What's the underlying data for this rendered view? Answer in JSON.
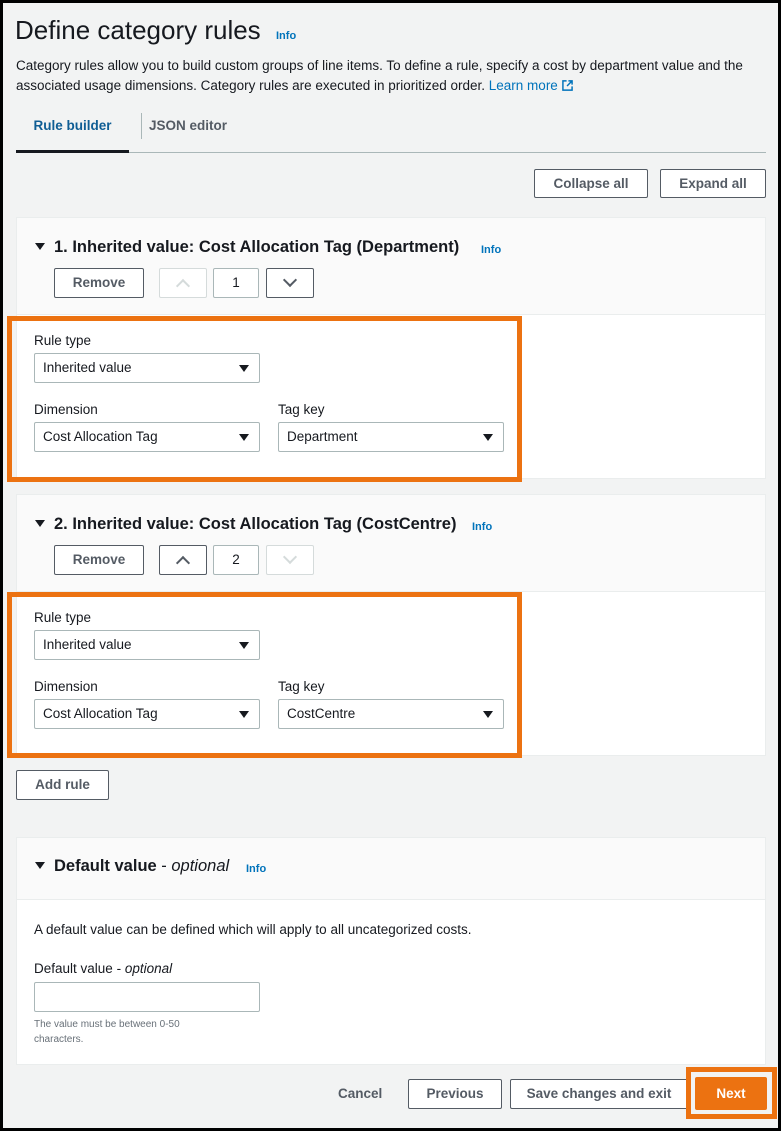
{
  "page": {
    "title": "Define category rules",
    "title_info": "Info",
    "description": "Category rules allow you to build custom groups of line items. To define a rule, specify a cost by department value and the associated usage dimensions. Category rules are executed in prioritized order.",
    "learn_more": "Learn more"
  },
  "tabs": [
    {
      "label": "Rule builder",
      "active": true
    },
    {
      "label": "JSON editor",
      "active": false
    }
  ],
  "toolbar": {
    "collapse_all": "Collapse all",
    "expand_all": "Expand all"
  },
  "rules": [
    {
      "title": "1. Inherited value: Cost Allocation Tag (Department)",
      "info": "Info",
      "remove": "Remove",
      "order": "1",
      "rule_type_label": "Rule type",
      "rule_type_value": "Inherited value",
      "dimension_label": "Dimension",
      "dimension_value": "Cost Allocation Tag",
      "tag_key_label": "Tag key",
      "tag_key_value": "Department"
    },
    {
      "title": "2. Inherited value: Cost Allocation Tag (CostCentre)",
      "info": "Info",
      "remove": "Remove",
      "order": "2",
      "rule_type_label": "Rule type",
      "rule_type_value": "Inherited value",
      "dimension_label": "Dimension",
      "dimension_value": "Cost Allocation Tag",
      "tag_key_label": "Tag key",
      "tag_key_value": "CostCentre"
    }
  ],
  "add_rule": "Add rule",
  "default_value": {
    "title": "Default value",
    "title_suffix": "optional",
    "info": "Info",
    "description": "A default value can be defined which will apply to all uncategorized costs.",
    "field_label": "Default value",
    "field_label_suffix": "optional",
    "field_value": "",
    "hint": "The value must be between 0-50 characters."
  },
  "footer": {
    "cancel": "Cancel",
    "previous": "Previous",
    "save_exit": "Save changes and exit",
    "next": "Next"
  },
  "colors": {
    "accent": "#ec7211",
    "link": "#0073bb",
    "highlight_frame": "#ec7211"
  },
  "icons": [
    "external-link-icon",
    "caret-down-icon",
    "chevron-up-icon",
    "chevron-down-icon",
    "select-triangle-icon"
  ]
}
